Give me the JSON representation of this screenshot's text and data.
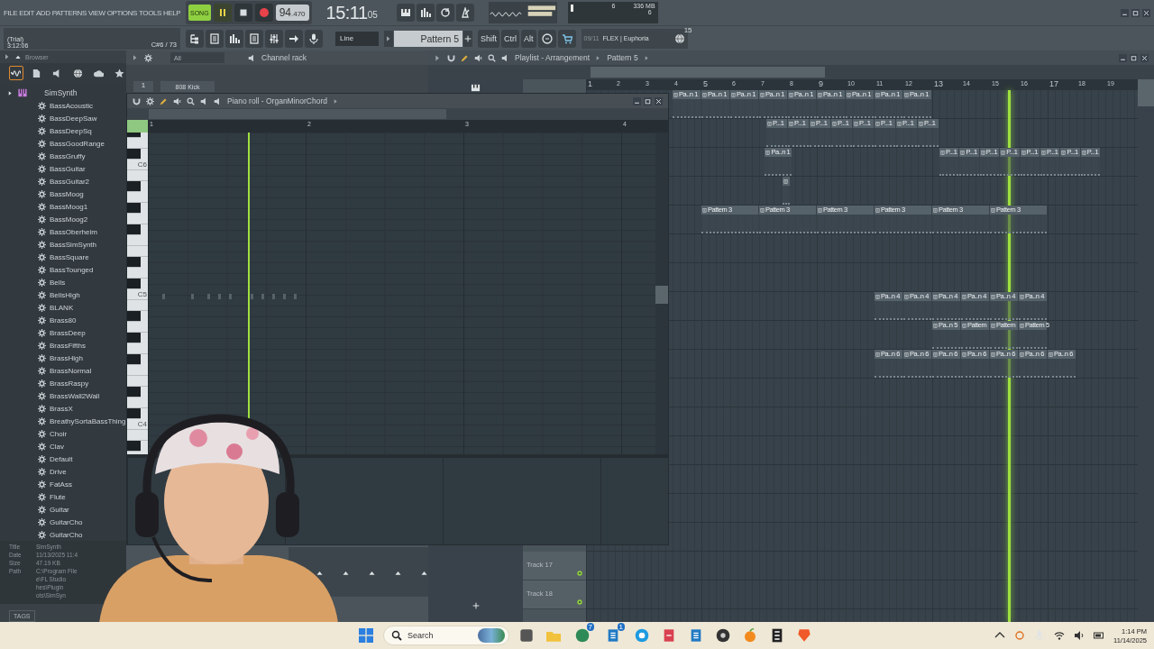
{
  "menu": [
    "FILE",
    "EDIT",
    "ADD",
    "PATTERNS",
    "VIEW",
    "OPTIONS",
    "TOOLS",
    "HELP"
  ],
  "transport": {
    "mode_label": "SONG",
    "song_mode": true,
    "playing": true,
    "tempo_whole": "94",
    "tempo_fraction": ".470",
    "time": "15:11",
    "time_small": "05"
  },
  "hint_panel": {
    "title": "(Trial)",
    "position": "3:12:06",
    "note": "C#6 / 73"
  },
  "snap": "Line",
  "pattern": "Pattern 5",
  "modifier_keys": [
    "Shift",
    "Ctrl",
    "Alt"
  ],
  "plugin_info": {
    "index": "09/11",
    "name": "FLEX | Euphoria",
    "badge": "15"
  },
  "monitor": {
    "cpu": "6",
    "memory": "336 MB",
    "polyphony": "6"
  },
  "browser": {
    "title": "Browser",
    "root": "SimSynth",
    "expanded": true,
    "items": [
      "BassAcoustic",
      "BassDeepSaw",
      "BassDeepSq",
      "BassGoodRange",
      "BassGruffy",
      "BassGuitar",
      "BassGuitar2",
      "BassMoog",
      "BassMoog1",
      "BassMoog2",
      "BassOberheim",
      "BassSimSynth",
      "BassSquare",
      "BassTounged",
      "Bells",
      "BellsHigh",
      "BLANK",
      "Brass80",
      "BrassDeep",
      "BrassFifths",
      "BrassHigh",
      "BrassNormal",
      "BrassRaspy",
      "BrassWall2Wall",
      "BrassX",
      "BreathySortaBassThing",
      "Choir",
      "Clav",
      "Default",
      "Drive",
      "FatAss",
      "Flute",
      "Guitar",
      "GuitarCho",
      "GuitarCho"
    ],
    "info": [
      {
        "label": "Title",
        "value": "SimSynth"
      },
      {
        "label": "Date",
        "value": "11/13/2025 11:4"
      },
      {
        "label": "Size",
        "value": "47.19 KB"
      },
      {
        "label": "Path",
        "value": "C:\\Program File"
      }
    ],
    "path_lines": [
      "e\\FL Studio",
      "hes\\Plugin",
      "ots\\SimSyn"
    ],
    "tags_label": "TAGS",
    "tabs": [
      {
        "selected": true
      },
      {
        "selected": false
      },
      {
        "selected": false
      },
      {
        "selected": false
      },
      {
        "selected": false
      },
      {
        "selected": false
      }
    ]
  },
  "channel_rack": {
    "filter": "All",
    "title": "Channel rack",
    "channel_number": "1",
    "channel_name": "808 Kick"
  },
  "piano_roll": {
    "title": "Piano roll - OrganMinorChord",
    "ruler": [
      "1",
      "2",
      "3",
      "4"
    ],
    "key_labels": [
      "C6",
      "C5",
      "C4"
    ]
  },
  "playlist": {
    "title": "Playlist - Arrangement",
    "pattern": "Pattern 5",
    "ruler": [
      "1",
      "2",
      "3",
      "4",
      "5",
      "6",
      "7",
      "8",
      "9",
      "10",
      "11",
      "12",
      "13",
      "14",
      "15",
      "16",
      "17",
      "18",
      "19"
    ],
    "track_labels": [
      "Track 17",
      "Track 18"
    ],
    "lanes": [
      {
        "clips": [
          "Pa..n 1",
          "Pa..n 1",
          "Pa..n 1",
          "Pa..n 1",
          "Pa..n 1",
          "Pa..n 1",
          "Pa..n 1",
          "Pa..n 1",
          "Pa..n 1"
        ]
      },
      {
        "clips": [
          "P...1",
          "P...1",
          "P...1",
          "P...1",
          "P...1",
          "P...1",
          "P...1",
          "P...1"
        ]
      },
      {
        "clips": [
          "Pa..n 1",
          "P...1",
          "P...1",
          "P...1",
          "P...1",
          "P...1",
          "P...1",
          "P...1",
          "P...1"
        ]
      },
      {
        "clips": [
          "Pattern 3",
          "Pattern 3",
          "Pattern 3",
          "Pattern 3",
          "Pattern 3",
          "Pattern 3"
        ]
      },
      {
        "clips": [
          "Pa..n 4",
          "Pa..n 4",
          "Pa..n 4",
          "Pa..n 4",
          "Pa..n 4",
          "Pa..n 4"
        ]
      },
      {
        "clips": [
          "Pa..n 5",
          "Pattern",
          "Pattern",
          "Pattern 5"
        ]
      },
      {
        "clips": [
          "Pa..n 6",
          "Pa..n 6",
          "Pa..n 6",
          "Pa..n 6",
          "Pa..n 6",
          "Pa..n 6",
          "Pa..n 6"
        ]
      }
    ]
  },
  "webcam": {
    "kind": "picture"
  },
  "taskbar": {
    "search_label": "Search",
    "badges": [
      "7",
      "1"
    ],
    "time": "1:14 PM",
    "date": "11/14/2025"
  }
}
